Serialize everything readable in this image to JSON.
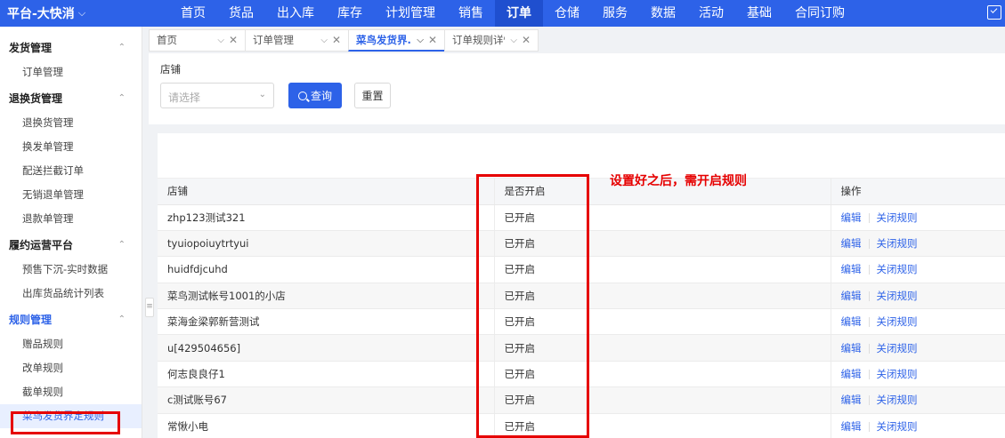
{
  "brand": {
    "title": "平台-大快消",
    "chevron": "⌵"
  },
  "top_nav": [
    {
      "label": "首页"
    },
    {
      "label": "货品"
    },
    {
      "label": "出入库"
    },
    {
      "label": "库存"
    },
    {
      "label": "计划管理"
    },
    {
      "label": "销售"
    },
    {
      "label": "订单",
      "active": true
    },
    {
      "label": "仓储"
    },
    {
      "label": "服务"
    },
    {
      "label": "数据"
    },
    {
      "label": "活动"
    },
    {
      "label": "基础"
    },
    {
      "label": "合同订购"
    }
  ],
  "sidebar": {
    "groups": [
      {
        "label": "发货管理",
        "items": [
          "订单管理"
        ]
      },
      {
        "label": "退换货管理",
        "items": [
          "退换货管理",
          "换发单管理",
          "配送拦截订单",
          "无销退单管理",
          "退款单管理"
        ]
      },
      {
        "label": "履约运营平台",
        "items": [
          "预售下沉-实时数据",
          "出库货品统计列表"
        ]
      },
      {
        "label": "规则管理",
        "items": [
          "赠品规则",
          "改单规则",
          "截单规则",
          "菜鸟发货界定规则"
        ]
      }
    ],
    "active_item": "菜鸟发货界定规则"
  },
  "tabs": [
    {
      "label": "首页"
    },
    {
      "label": "订单管理"
    },
    {
      "label": "菜鸟发货界...",
      "active": true
    },
    {
      "label": "订单规则详情"
    }
  ],
  "filter": {
    "shop_label": "店铺",
    "shop_placeholder": "请选择",
    "query_label": "查询",
    "reset_label": "重置"
  },
  "table": {
    "headers": {
      "shop": "店铺",
      "status": "是否开启",
      "ops": "操作"
    },
    "rows": [
      {
        "shop": "zhp123测试321",
        "status": "已开启"
      },
      {
        "shop": "tyuiopoiuytrtyui",
        "status": "已开启"
      },
      {
        "shop": "huidfdjcuhd",
        "status": "已开启"
      },
      {
        "shop": "菜鸟测试帐号1001的小店",
        "status": "已开启"
      },
      {
        "shop": "菜海金梁郭新营测试",
        "status": "已开启"
      },
      {
        "shop": "u[429504656]",
        "status": "已开启"
      },
      {
        "shop": "何志良良仔1",
        "status": "已开启"
      },
      {
        "shop": "c测试账号67",
        "status": "已开启"
      },
      {
        "shop": "常愀小电",
        "status": "已开启"
      }
    ],
    "edit_label": "编辑",
    "close_label": "关闭规则"
  },
  "annotation": {
    "text": "设置好之后，需开启规则",
    "color": "#e60000"
  },
  "colors": {
    "primary": "#2d62e8",
    "annotation": "#e60000"
  }
}
